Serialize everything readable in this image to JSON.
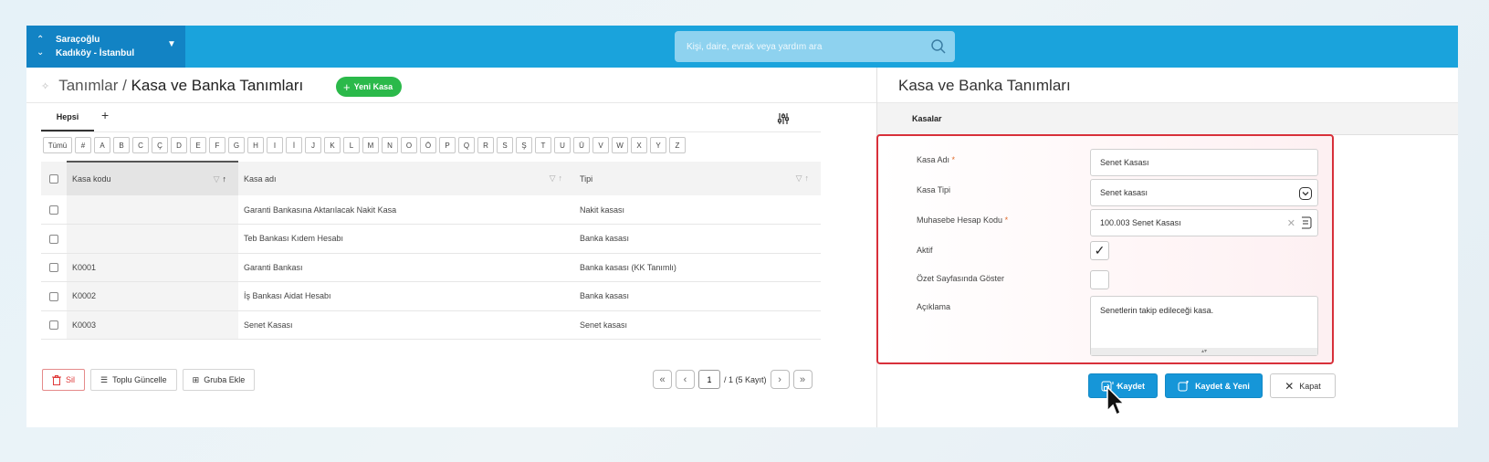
{
  "topbar": {
    "location_line1": "Saraçoğlu",
    "location_line2": "Kadıköy - İstanbul",
    "search_placeholder": "Kişi, daire, evrak veya yardım ara"
  },
  "left": {
    "breadcrumb_parent": "Tanımlar / ",
    "breadcrumb_current": "Kasa ve Banka Tanımları",
    "new_button": "Yeni Kasa",
    "tab_all": "Hepsi",
    "tab_add": "+",
    "letters": [
      "Tümü",
      "#",
      "A",
      "B",
      "C",
      "Ç",
      "D",
      "E",
      "F",
      "G",
      "H",
      "I",
      "İ",
      "J",
      "K",
      "L",
      "M",
      "N",
      "O",
      "Ö",
      "P",
      "Q",
      "R",
      "S",
      "Ş",
      "T",
      "U",
      "Ü",
      "V",
      "W",
      "X",
      "Y",
      "Z"
    ],
    "columns": {
      "code": "Kasa kodu",
      "name": "Kasa adı",
      "type": "Tipi"
    },
    "rows": [
      {
        "code": "",
        "name": "Garanti Bankasına Aktarılacak Nakit Kasa",
        "type": "Nakit kasası"
      },
      {
        "code": "",
        "name": "Teb Bankası Kıdem Hesabı",
        "type": "Banka kasası"
      },
      {
        "code": "K0001",
        "name": "Garanti Bankası",
        "type": "Banka kasası (KK Tanımlı)"
      },
      {
        "code": "K0002",
        "name": "İş Bankası Aidat Hesabı",
        "type": "Banka kasası"
      },
      {
        "code": "K0003",
        "name": "Senet Kasası",
        "type": "Senet kasası"
      }
    ],
    "actions": {
      "delete": "Sil",
      "bulk_update": "Toplu Güncelle",
      "add_group": "Gruba Ekle"
    },
    "pager": {
      "page": "1",
      "summary": "/ 1 (5 Kayıt)"
    }
  },
  "right": {
    "title": "Kasa ve Banka Tanımları",
    "tab": "Kasalar",
    "form": {
      "name_label": "Kasa Adı",
      "name_value": "Senet Kasası",
      "type_label": "Kasa Tipi",
      "type_value": "Senet kasası",
      "account_label": "Muhasebe Hesap Kodu",
      "account_value": "100.003  Senet Kasası",
      "active_label": "Aktif",
      "summary_label": "Özet Sayfasında Göster",
      "desc_label": "Açıklama",
      "desc_value": "Senetlerin takip edileceği kasa."
    },
    "buttons": {
      "save": "Kaydet",
      "save_new": "Kaydet & Yeni",
      "close": "Kapat"
    }
  },
  "colors": {
    "topbar": "#1aa3dc",
    "accent_green": "#2bb94a",
    "primary_blue": "#1696d8",
    "highlight_red": "#d8303a"
  }
}
